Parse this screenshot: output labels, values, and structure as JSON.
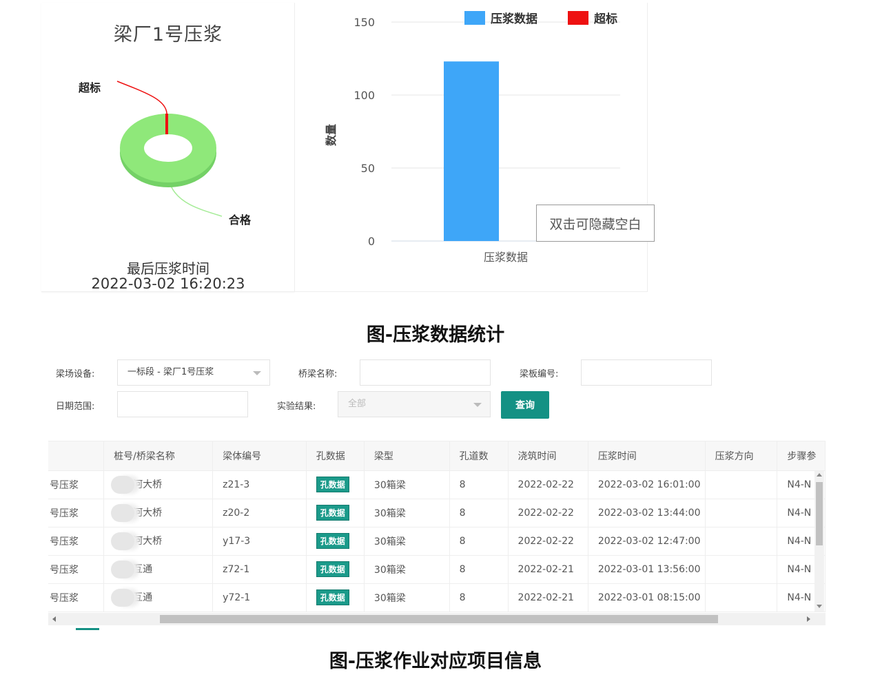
{
  "donut": {
    "title": "梁厂1号压浆",
    "label_over": "超标",
    "label_ok": "合格",
    "last_title": "最后压浆时间",
    "last_time": "2022-03-02 16:20:23",
    "values": {
      "ok_fraction": 0.99,
      "over_fraction": 0.01
    },
    "colors": {
      "ok": "#8fe87a",
      "over": "#ee1111"
    }
  },
  "chart_data": {
    "type": "bar",
    "categories": [
      "压浆数据"
    ],
    "series": [
      {
        "name": "压浆数据",
        "values": [
          123
        ],
        "color": "#3ea6f8"
      },
      {
        "name": "超标",
        "values": [
          0
        ],
        "color": "#ee1111"
      }
    ],
    "ylabel": "数量",
    "ylim": [
      0,
      150
    ],
    "yticks": [
      0,
      50,
      100,
      150
    ],
    "grid": true,
    "legend": "top-right",
    "tooltip": "双击可隐藏空白"
  },
  "captions": {
    "fig1": "图-压浆数据统计",
    "fig2": "图-压浆作业对应项目信息"
  },
  "filters": {
    "device_label": "梁场设备:",
    "device_value": "一标段 - 梁厂1号压浆",
    "bridge_label": "桥梁名称:",
    "bridge_value": "",
    "beam_label": "梁板编号:",
    "beam_value": "",
    "date_label": "日期范围:",
    "date_value": "",
    "result_label": "实验结果:",
    "result_value": "全部",
    "query_button": "查询"
  },
  "table": {
    "headers": [
      "",
      "桩号/桥梁名称",
      "梁体编号",
      "孔数据",
      "梁型",
      "孔道数",
      "浇筑时间",
      "压浆时间",
      "压浆方向",
      "步骤参"
    ],
    "tag_label": "孔数据",
    "rows": [
      [
        "号压浆",
        "河大桥",
        "z21-3",
        "30箱梁",
        "8",
        "2022-02-22",
        "2022-03-02 16:01:00",
        "",
        "N4-N"
      ],
      [
        "号压浆",
        "河大桥",
        "z20-2",
        "30箱梁",
        "8",
        "2022-02-22",
        "2022-03-02 13:44:00",
        "",
        "N4-N"
      ],
      [
        "号压浆",
        "河大桥",
        "y17-3",
        "30箱梁",
        "8",
        "2022-02-22",
        "2022-03-02 12:47:00",
        "",
        "N4-N"
      ],
      [
        "号压浆",
        "互通",
        "z72-1",
        "30箱梁",
        "8",
        "2022-02-21",
        "2022-03-01 13:56:00",
        "",
        "N4-N"
      ],
      [
        "号压浆",
        "互通",
        "y72-1",
        "30箱梁",
        "8",
        "2022-02-21",
        "2022-03-01 08:15:00",
        "",
        "N4-N"
      ]
    ]
  }
}
